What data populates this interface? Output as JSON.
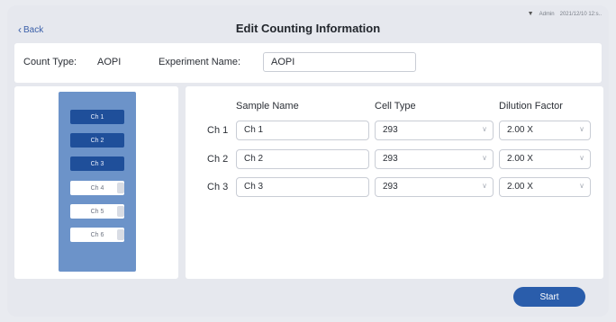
{
  "header": {
    "back_label": "Back",
    "title": "Edit Counting Information",
    "status_user": "Admin",
    "status_time": "2021/12/10 12:s.."
  },
  "info": {
    "count_type_label": "Count Type:",
    "count_type_value": "AOPI",
    "experiment_name_label": "Experiment Name:",
    "experiment_name_value": "AOPI"
  },
  "channels": [
    {
      "label": "Ch 1",
      "active": true
    },
    {
      "label": "Ch 2",
      "active": true
    },
    {
      "label": "Ch 3",
      "active": true
    },
    {
      "label": "Ch 4",
      "active": false
    },
    {
      "label": "Ch 5",
      "active": false
    },
    {
      "label": "Ch 6",
      "active": false
    }
  ],
  "table": {
    "headers": {
      "sample_name": "Sample Name",
      "cell_type": "Cell Type",
      "dilution_factor": "Dilution Factor"
    },
    "rows": [
      {
        "channel": "Ch 1",
        "sample_name": "Ch 1",
        "cell_type": "293",
        "dilution_factor": "2.00 X"
      },
      {
        "channel": "Ch 2",
        "sample_name": "Ch 2",
        "cell_type": "293",
        "dilution_factor": "2.00 X"
      },
      {
        "channel": "Ch 3",
        "sample_name": "Ch 3",
        "cell_type": "293",
        "dilution_factor": "2.00 X"
      }
    ]
  },
  "actions": {
    "start_label": "Start"
  },
  "colors": {
    "accent": "#2a5dab",
    "channel_active": "#1f4f9a",
    "channel_column": "#6c93c9"
  },
  "icons": {
    "back": "chevron-left-icon",
    "dropdown": "chevron-down-icon",
    "wifi": "wifi-icon"
  }
}
